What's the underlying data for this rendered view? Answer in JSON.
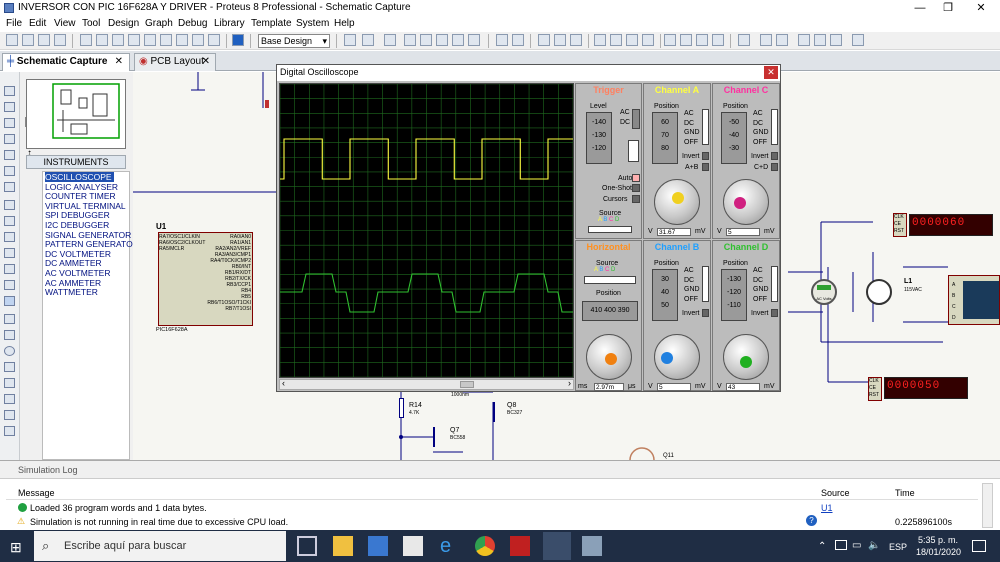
{
  "window": {
    "title": "INVERSOR CON PIC 16F628A Y DRIVER - Proteus 8 Professional - Schematic Capture",
    "minimize": "—",
    "maximize": "❐",
    "close": "✕"
  },
  "menu": [
    "File",
    "Edit",
    "View",
    "Tool",
    "Design",
    "Graph",
    "Debug",
    "Library",
    "Template",
    "System",
    "Help"
  ],
  "toolbar": {
    "design_select": "Base Design"
  },
  "tabs": [
    {
      "label": "Schematic Capture"
    },
    {
      "label": "PCB Layout"
    }
  ],
  "left": {
    "rotation": "0°"
  },
  "instruments": {
    "header": "INSTRUMENTS",
    "items": [
      "OSCILLOSCOPE",
      "LOGIC ANALYSER",
      "COUNTER TIMER",
      "VIRTUAL TERMINAL",
      "SPI DEBUGGER",
      "I2C DEBUGGER",
      "SIGNAL GENERATOR",
      "PATTERN GENERATOR",
      "DC VOLTMETER",
      "DC AMMETER",
      "AC VOLTMETER",
      "AC AMMETER",
      "WATTMETER"
    ],
    "selected": 0
  },
  "schematic": {
    "u1_label": "U1",
    "u1_part": "PIC16F628A",
    "u1_left_pins": [
      "RA7/OSC1/CLKIN",
      "RA6/OSC2/CLKOUT",
      "",
      "RA5/MCLR"
    ],
    "u1_right_pins": [
      "RA0/AN0",
      "RA1/AN1",
      "RA2/AN2/VREF",
      "RA3/AN3/CMP1",
      "RA4/T0CKI/CMP2",
      "",
      "RB0/INT",
      "RB1/RX/DT",
      "RB2/TX/CK",
      "RB3/CCP1",
      "RB4",
      "RB5",
      "RB6/T1OSO/T1CKI",
      "RB7/T1OSI"
    ],
    "r14": "R14",
    "r14_val": "4.7K",
    "q7": "Q7",
    "q7_part": "BC558",
    "q8": "Q8",
    "q8_part": "BC327",
    "l1": "L1",
    "l1_val": "115VAC",
    "meter": "AC Volts",
    "counter_pins": [
      "CLK",
      "CE",
      "RST"
    ],
    "counter1": "0000060",
    "counter2": "0000050",
    "osc_ports": [
      "A",
      "B",
      "C",
      "D"
    ],
    "q11": "Q11",
    "partial_value": "1000hm"
  },
  "scope": {
    "title": "Digital Oscilloscope",
    "trigger": {
      "title": "Trigger",
      "level_label": "Level",
      "level_vals": [
        "-140",
        "-130",
        "-120"
      ],
      "ac": "AC",
      "dc": "DC",
      "auto": "Auto",
      "oneshot": "One-Shot",
      "cursors": "Cursors",
      "source": "Source",
      "source_letters": [
        "A",
        "B",
        "C",
        "D"
      ]
    },
    "chA": {
      "title": "Channel A",
      "position": "Position",
      "pos_vals": [
        "60",
        "70",
        "80"
      ],
      "modes": [
        "AC",
        "DC",
        "GND",
        "OFF"
      ],
      "invert": "Invert",
      "aplusb": "A+B",
      "value": "31.67",
      "unit": "mV",
      "vlabel": "V"
    },
    "chB": {
      "title": "Channel B",
      "position": "Position",
      "pos_vals": [
        "30",
        "40",
        "50"
      ],
      "modes": [
        "AC",
        "DC",
        "GND",
        "OFF"
      ],
      "invert": "Invert",
      "value": "5",
      "unit": "mV",
      "vlabel": "V"
    },
    "chC": {
      "title": "Channel C",
      "position": "Position",
      "pos_vals": [
        "-50",
        "-40",
        "-30"
      ],
      "modes": [
        "AC",
        "DC",
        "GND",
        "OFF"
      ],
      "invert": "Invert",
      "cplusd": "C+D",
      "value": "5",
      "unit": "mV",
      "vlabel": "V"
    },
    "chD": {
      "title": "Channel D",
      "position": "Position",
      "pos_vals": [
        "-130",
        "-120",
        "-110"
      ],
      "modes": [
        "AC",
        "DC",
        "GND",
        "OFF"
      ],
      "invert": "Invert",
      "value": "43",
      "unit": "mV",
      "vlabel": "V"
    },
    "horizontal": {
      "title": "Horizontal",
      "source": "Source",
      "source_letters": [
        "A",
        "B",
        "C",
        "D"
      ],
      "position": "Position",
      "pos_vals": [
        "410",
        "400",
        "390"
      ],
      "value": "2.97m",
      "unit_ms": "ms",
      "unit_us": "μs"
    },
    "colors": {
      "chA": "#ffff40",
      "chB": "#20a0ff",
      "chC": "#ff30a0",
      "chD": "#30c030",
      "trigger": "#ff6040",
      "horizontal": "#ff9020",
      "grid": "#1f6a1f"
    }
  },
  "simlog": {
    "title": "Simulation Log",
    "col_message": "Message",
    "col_source": "Source",
    "col_time": "Time",
    "rows": [
      {
        "icon": "info-icon",
        "message": "Loaded 36 program words and 1 data bytes.",
        "source": "U1",
        "time": ""
      },
      {
        "icon": "warning-icon",
        "message": "Simulation is not running in real time due to excessive CPU load.",
        "source": "",
        "time": "0.225896100s"
      }
    ]
  },
  "taskbar": {
    "search_placeholder": "Escribe aquí para buscar",
    "time": "5:35 p. m.",
    "date": "18/01/2020",
    "lang": "ESP"
  }
}
